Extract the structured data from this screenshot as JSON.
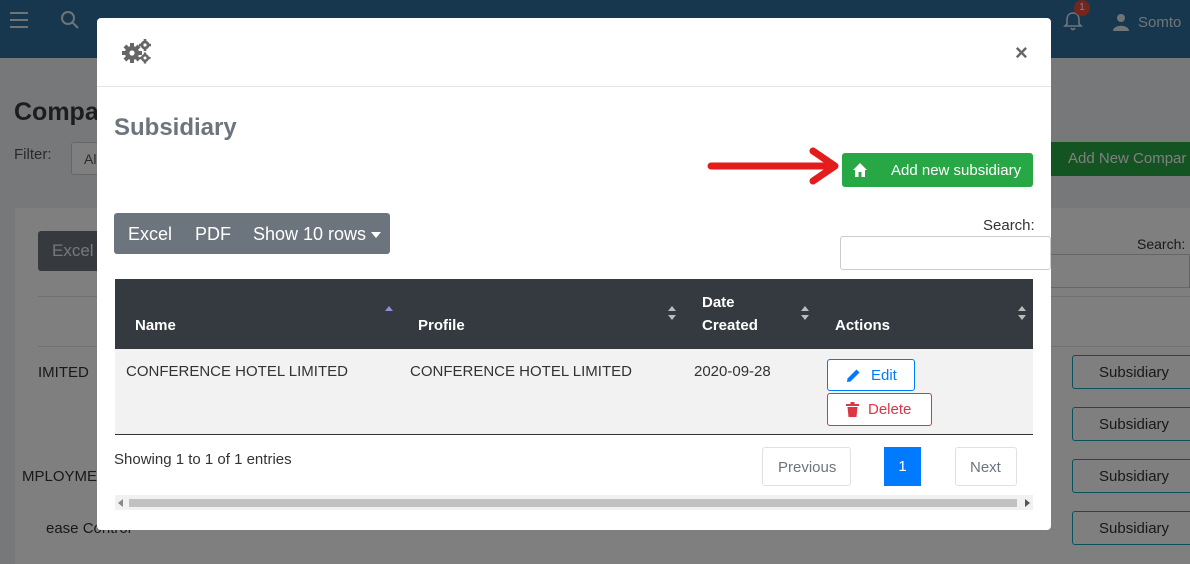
{
  "background": {
    "user_name": "Somto",
    "notification_count": "1",
    "page_title": "Compa",
    "filter_label": "Filter:",
    "filter_value": "Al",
    "add_company_label": "Add New Compar",
    "excel_label": "Excel",
    "search_label": "Search:",
    "rows": [
      {
        "left_text": "IMITED",
        "button": "Subsidiary"
      },
      {
        "left_text": "",
        "button": "Subsidiary"
      },
      {
        "left_text": "MPLOYME",
        "button": "Subsidiary"
      },
      {
        "left_text": "ease Control",
        "button": "Subsidiary"
      }
    ]
  },
  "modal": {
    "title": "Subsidiary",
    "add_button_label": "Add new subsidiary",
    "toolbar": {
      "excel": "Excel",
      "pdf": "PDF",
      "show_rows": "Show 10 rows"
    },
    "search_label": "Search:",
    "search_value": "",
    "table": {
      "headers": {
        "name": "Name",
        "profile": "Profile",
        "date_line1": "Date",
        "date_line2": "Created",
        "actions": "Actions"
      },
      "rows": [
        {
          "name": "CONFERENCE HOTEL LIMITED",
          "profile": "CONFERENCE HOTEL LIMITED",
          "date_created": "2020-09-28",
          "edit_label": "Edit",
          "delete_label": "Delete"
        }
      ]
    },
    "info": "Showing 1 to 1 of 1 entries",
    "pagination": {
      "previous": "Previous",
      "current": "1",
      "next": "Next"
    }
  },
  "colors": {
    "accent_green": "#28a745",
    "primary_blue": "#007bff",
    "danger_red": "#dc3545",
    "header_dark": "#343a40",
    "arrow_red": "#e31c1c"
  }
}
